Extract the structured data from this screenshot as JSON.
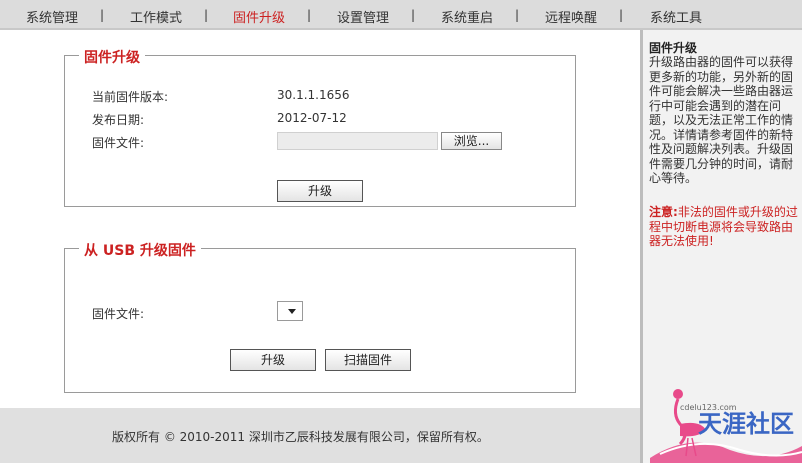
{
  "nav": {
    "items": [
      "系统管理",
      "工作模式",
      "固件升级",
      "设置管理",
      "系统重启",
      "远程唤醒",
      "系统工具"
    ],
    "active_index": 2,
    "separator": "|"
  },
  "firmware_section": {
    "title": "固件升级",
    "current_version_label": "当前固件版本:",
    "current_version_value": "30.1.1.1656",
    "release_date_label": "发布日期:",
    "release_date_value": "2012-07-12",
    "file_label": "固件文件:",
    "browse_button": "浏览...",
    "upgrade_button": "升级"
  },
  "usb_section": {
    "title": "从 USB 升级固件",
    "file_label": "固件文件:",
    "upgrade_button": "升级",
    "scan_button": "扫描固件"
  },
  "help": {
    "title": "固件升级",
    "body": "升级路由器的固件可以获得更多新的功能，另外新的固件可能会解决一些路由器运行中可能会遇到的潜在问题，以及无法正常工作的情况。详情请参考固件的新特性及问题解决列表。升级固件需要几分钟的时间，请耐心等待。",
    "warning_prefix": "注意:",
    "warning_text": "非法的固件或升级的过程中切断电源将会导致路由器无法使用!"
  },
  "footer": {
    "copyright": "版权所有 © 2010-2011 深圳市乙辰科技发展有限公司，保留所有权。"
  },
  "watermark": {
    "url": "cdelu123.com",
    "name": "天涯社区"
  },
  "colors": {
    "accent": "#cc2222",
    "nav_bg": "#dcdcdc",
    "sidebar_bg": "#f2f2f2",
    "footer_bg": "#e0e0e0"
  }
}
